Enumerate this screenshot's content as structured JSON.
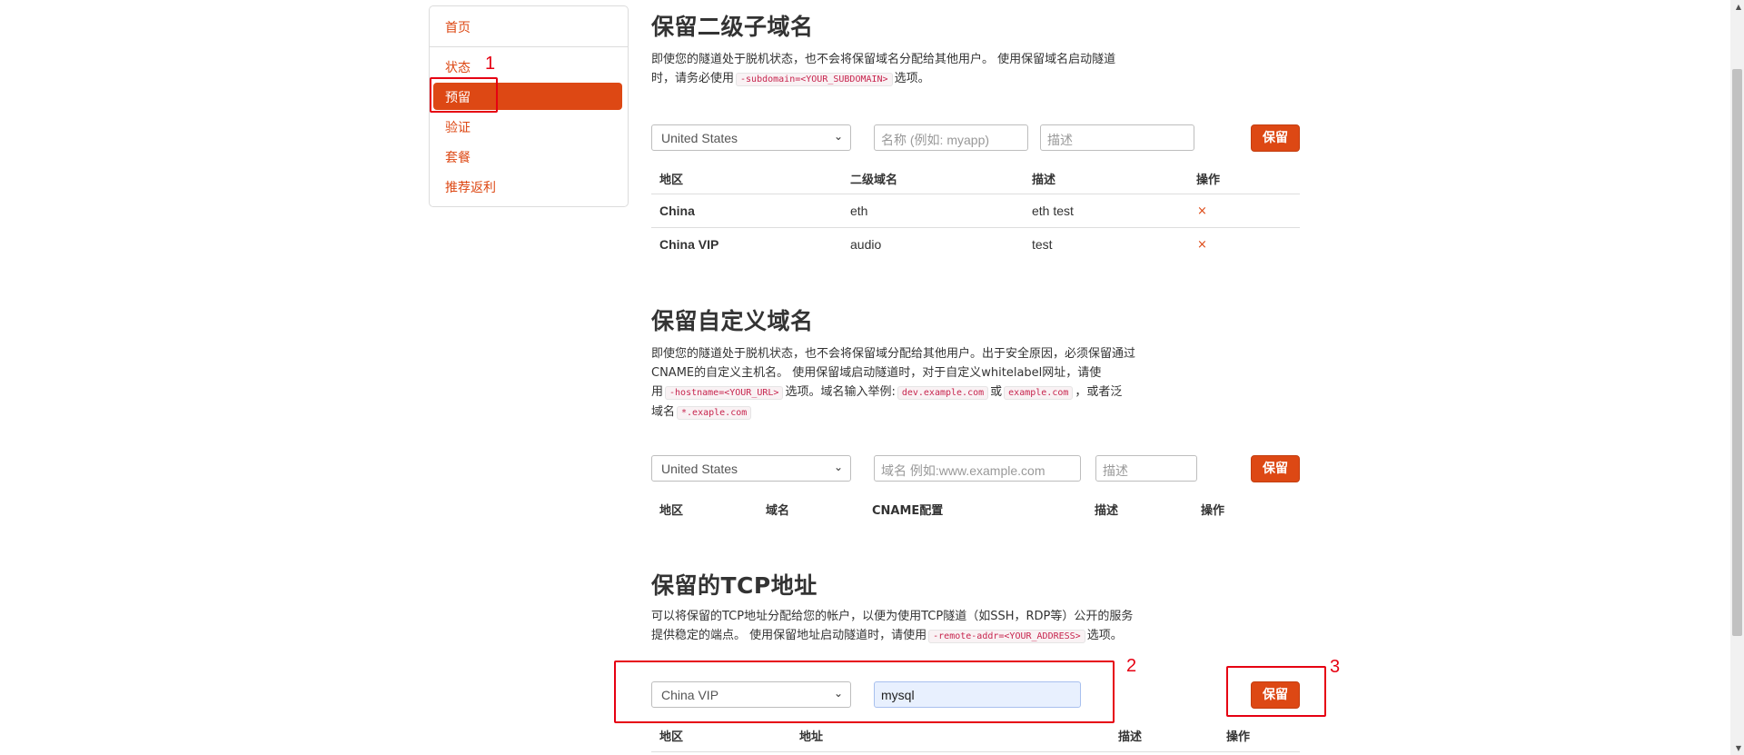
{
  "sidebar": {
    "items": [
      {
        "label": "首页"
      },
      {
        "label": "状态"
      },
      {
        "label": "预留"
      },
      {
        "label": "验证"
      },
      {
        "label": "套餐"
      },
      {
        "label": "推荐返利"
      }
    ]
  },
  "subdomain": {
    "title": "保留二级子域名",
    "desc_1": "即使您的隧道处于脱机状态，也不会将保留域名分配给其他用户。 使用保留域名启动隧道",
    "desc_2a": "时，请务必使用",
    "desc_2_code": "-subdomain=<YOUR_SUBDOMAIN>",
    "desc_2b": "选项。",
    "region_value": "United States",
    "name_placeholder": "名称 (例如: myapp)",
    "desc_placeholder": "描述",
    "save_label": "保留",
    "columns": [
      "地区",
      "二级域名",
      "描述",
      "操作"
    ],
    "rows": [
      {
        "region": "China",
        "subdomain": "eth",
        "desc": "eth test",
        "action": "×"
      },
      {
        "region": "China VIP",
        "subdomain": "audio",
        "desc": "test",
        "action": "×"
      }
    ]
  },
  "custom_domain": {
    "title": "保留自定义域名",
    "desc_1": "即使您的隧道处于脱机状态，也不会将保留域分配给其他用户。出于安全原因，必须保留通过",
    "desc_2": "CNAME的自定义主机名。 使用保留域启动隧道时，对于自定义whitelabel网址，请使",
    "desc_3a": "用",
    "desc_3_code1": "-hostname=<YOUR_URL>",
    "desc_3b": "选项。域名输入举例:",
    "desc_3_code2": "dev.example.com",
    "desc_3c": "或",
    "desc_3_code3": "example.com",
    "desc_3d": "，或者泛",
    "desc_4a": "域名",
    "desc_4_code": "*.exaple.com",
    "region_value": "United States",
    "domain_placeholder": "域名 例如:www.example.com",
    "desc_placeholder": "描述",
    "save_label": "保留",
    "columns": [
      "地区",
      "域名",
      "CNAME配置",
      "描述",
      "操作"
    ]
  },
  "tcp": {
    "title": "保留的TCP地址",
    "desc_1": "可以将保留的TCP地址分配给您的帐户，以便为使用TCP隧道（如SSH，RDP等）公开的服务",
    "desc_2a": "提供稳定的端点。 使用保留地址启动隧道时，请使用",
    "desc_2_code": "-remote-addr=<YOUR_ADDRESS>",
    "desc_2b": "选项。",
    "region_value": "China VIP",
    "addr_value": "mysql",
    "save_label": "保留",
    "columns": [
      "地区",
      "地址",
      "描述",
      "操作"
    ]
  },
  "annotations": [
    "1",
    "2",
    "3"
  ],
  "colors": {
    "accent": "#dd4814",
    "annotation": "#e60012"
  }
}
